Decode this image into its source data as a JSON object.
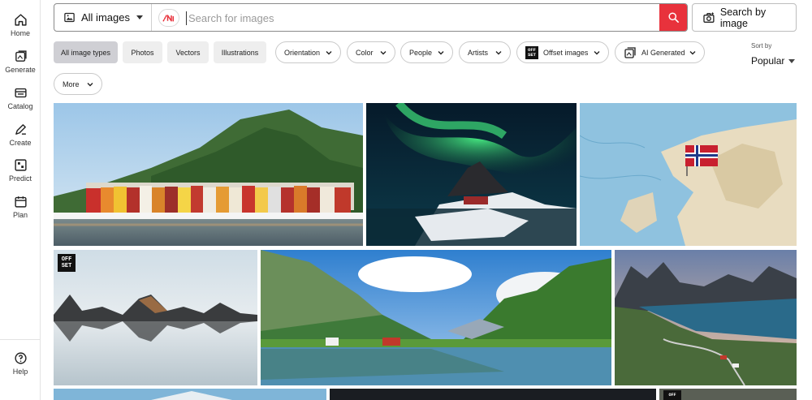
{
  "sidebar": {
    "items": [
      {
        "label": "Home",
        "icon": "home-icon"
      },
      {
        "label": "Generate",
        "icon": "generate-icon"
      },
      {
        "label": "Catalog",
        "icon": "catalog-icon"
      },
      {
        "label": "Create",
        "icon": "create-icon"
      },
      {
        "label": "Predict",
        "icon": "predict-icon"
      },
      {
        "label": "Plan",
        "icon": "plan-icon"
      }
    ],
    "help_label": "Help"
  },
  "search": {
    "type_label": "All images",
    "placeholder": "Search for images",
    "value": "",
    "search_by_image_label": "Search by image"
  },
  "filters": {
    "chips": [
      "All image types",
      "Photos",
      "Vectors",
      "Illustrations"
    ],
    "active_chip": "All image types",
    "dropdowns": [
      "Orientation",
      "Color",
      "People",
      "Artists",
      "Offset images",
      "AI Generated",
      "More"
    ],
    "offset_logo_text": [
      "OFF",
      "SET"
    ]
  },
  "sort": {
    "label": "Sort by",
    "value": "Popular"
  },
  "offset_badge_text": [
    "OFF",
    "SET"
  ],
  "colors": {
    "accent_red": "#e8323c",
    "active_chip": "#cfcfd4"
  }
}
